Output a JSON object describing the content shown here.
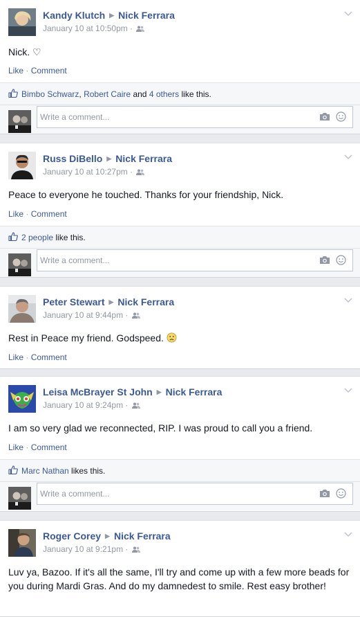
{
  "posts": [
    {
      "author": "Kandy Klutch",
      "target": "Nick Ferrara",
      "time": "January 10 at 10:50pm",
      "dot": "·",
      "message": "Nick.",
      "heart": "♡",
      "like": "Like",
      "dot2": "·",
      "comment": "Comment",
      "likes": {
        "name1": "Bimbo Schwarz",
        "comma": ",",
        "name2": "Robert Caire",
        "and": "and",
        "others": "4 others",
        "suffix": "like this."
      },
      "comment_placeholder": "Write a comment..."
    },
    {
      "author": "Russ DiBello",
      "target": "Nick Ferrara",
      "time": "January 10 at 10:27pm",
      "dot": "·",
      "message": "Peace to everyone he touched. Thanks for your friendship, Nick.",
      "like": "Like",
      "dot2": "·",
      "comment": "Comment",
      "likes": {
        "people": "2 people",
        "suffix": "like this."
      },
      "comment_placeholder": "Write a comment..."
    },
    {
      "author": "Peter Stewart",
      "target": "Nick Ferrara",
      "time": "January 10 at 9:44pm",
      "dot": "·",
      "message": "Rest in Peace my friend. Godspeed.",
      "like": "Like",
      "dot2": "·",
      "comment": "Comment"
    },
    {
      "author": "Leisa McBrayer St John",
      "target": "Nick Ferrara",
      "time": "January 10 at 9:24pm",
      "dot": "·",
      "message": "I am so very glad we reconnected, RIP. I was proud to call you a friend.",
      "like": "Like",
      "dot2": "·",
      "comment": "Comment",
      "likes": {
        "name1": "Marc Nathan",
        "suffix": "likes this."
      },
      "comment_placeholder": "Write a comment..."
    },
    {
      "author": "Roger Corey",
      "target": "Nick Ferrara",
      "time": "January 10 at 9:21pm",
      "dot": "·",
      "message": "Luv ya, Bazoo. If it's all the same, I'll try and come up with a few more beads for you during Mardi Gras. And do my damnedest to smile. Rest easy brother!"
    }
  ],
  "colors": {
    "link": "#3b5998",
    "meta": "#9197a3",
    "bg": "#e9eaed",
    "likebar": "#f6f7f8"
  }
}
